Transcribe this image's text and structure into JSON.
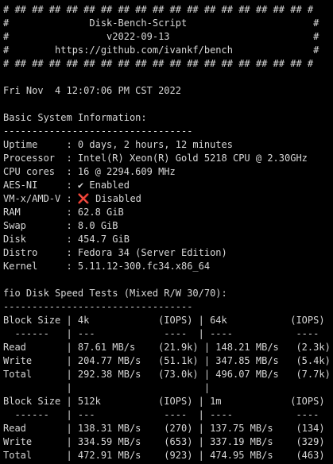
{
  "lines": [
    "# ## ## ## ## ## ## ## ## ## ## ## ## ## ## ## ## ## #",
    "#              Disk-Bench-Script                      #",
    "#                 v2022-09-13                         #",
    "#        https://github.com/ivankf/bench              #",
    "# ## ## ## ## ## ## ## ## ## ## ## ## ## ## ## ## ## #",
    "",
    "Fri Nov  4 12:07:06 PM CST 2022",
    "",
    "Basic System Information:",
    "---------------------------------",
    "Uptime     : 0 days, 2 hours, 12 minutes",
    "Processor  : Intel(R) Xeon(R) Gold 5218 CPU @ 2.30GHz",
    "CPU cores  : 16 @ 2294.609 MHz",
    "AES-NI     : ✔ Enabled",
    "VM-x/AMD-V : ",
    "RAM        : 62.8 GiB",
    "Swap       : 8.0 GiB",
    "Disk       : 454.7 GiB",
    "Distro     : Fedora 34 (Server Edition)",
    "Kernel     : 5.11.12-300.fc34.x86_64",
    "",
    "fio Disk Speed Tests (Mixed R/W 30/70):",
    "---------------------------------",
    "Block Size | 4k            (IOPS) | 64k           (IOPS)",
    "  ------   | ---            ----  | ----           ----",
    "Read       | 87.61 MB/s    (21.9k) | 148.21 MB/s   (2.3k)",
    "Write      | 204.77 MB/s   (51.1k) | 347.85 MB/s   (5.4k)",
    "Total      | 292.38 MB/s   (73.0k) | 496.07 MB/s   (7.7k)",
    "           |                       |",
    "Block Size | 512k          (IOPS) | 1m            (IOPS)",
    "  ------   | ---            ----  | ----           ----",
    "Read       | 138.31 MB/s    (270) | 137.75 MB/s    (134)",
    "Write      | 334.59 MB/s    (653) | 337.19 MB/s    (329)",
    "Total      | 472.91 MB/s    (923) | 474.95 MB/s    (463)"
  ],
  "vmx_status": {
    "icon": "❌",
    "label": " Disabled"
  },
  "colors": {
    "background": "#000000",
    "text": "#d8d8d8",
    "error_icon": "#e0402e"
  }
}
